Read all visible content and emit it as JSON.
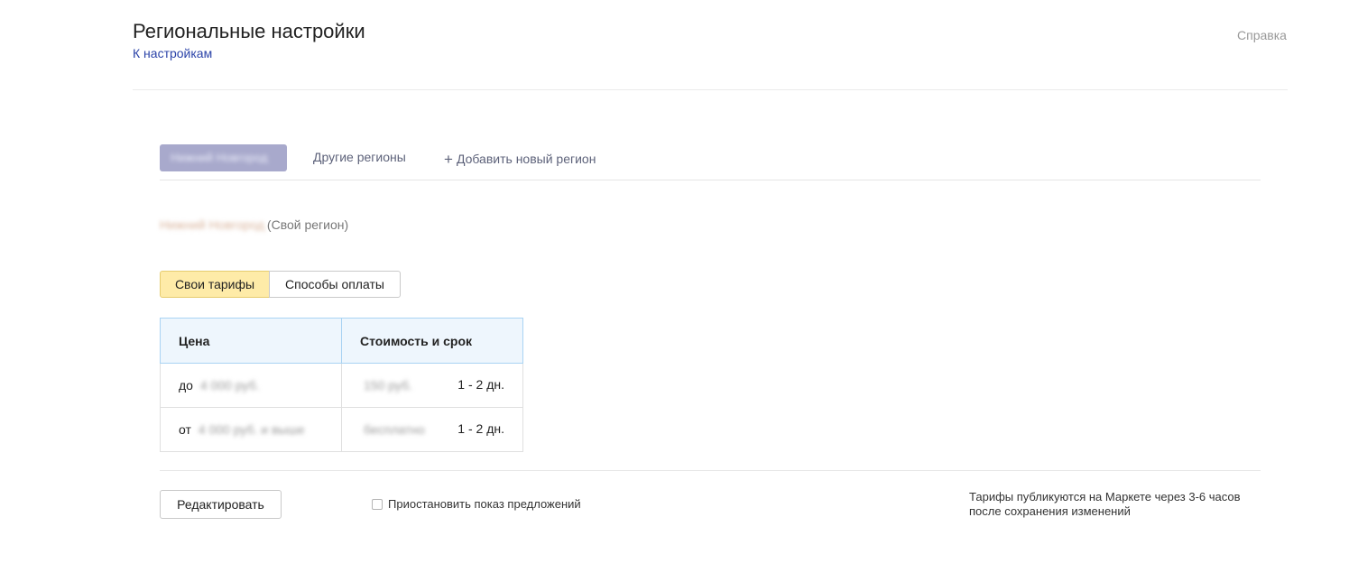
{
  "header": {
    "title": "Региональные настройки",
    "back_link": "К настройкам",
    "help_link": "Справка"
  },
  "region_tabs": {
    "active_label": "Нижний Новгород",
    "other_regions": "Другие регионы",
    "add_region": "Добавить новый регион",
    "add_icon": "+"
  },
  "region": {
    "name": "Нижний Новгород",
    "suffix": "(Свой регион)"
  },
  "segments": {
    "tariffs": "Свои тарифы",
    "payment": "Способы оплаты",
    "selected": "tariffs"
  },
  "table": {
    "headers": [
      "Цена",
      "Стоимость и срок"
    ],
    "rows": [
      {
        "price_prefix": "до",
        "price_value": "4 000 руб.",
        "cost_value": "150 руб.",
        "term": "1 - 2 дн."
      },
      {
        "price_prefix": "от",
        "price_value": "4 000 руб. и выше",
        "cost_value": "бесплатно",
        "term": "1 - 2 дн."
      }
    ]
  },
  "footer": {
    "edit_button": "Редактировать",
    "suspend_label": "Приостановить показ предложений",
    "suspend_checked": false,
    "note": "Тарифы публикуются на Маркете через 3-6 часов после сохранения изменений"
  },
  "colors": {
    "link": "#2b43a8",
    "active_tab": "#a8a9cc",
    "selected_segment": "#feeba8",
    "table_header_bg": "#eef6fd",
    "table_header_border": "#a9d3f3"
  }
}
